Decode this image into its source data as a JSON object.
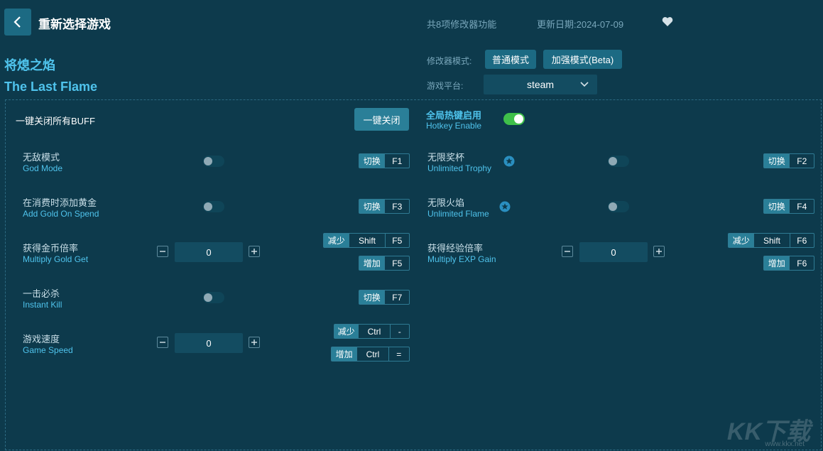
{
  "header": {
    "back_icon": "chevron-left-icon",
    "title": "重新选择游戏",
    "feature_count": "共8项修改器功能",
    "update_date": "更新日期:2024-07-09",
    "favorite_icon": "heart-icon"
  },
  "game": {
    "name_cn": "将熄之焰",
    "name_en": "The Last Flame"
  },
  "mode": {
    "label": "修改器模式:",
    "normal": "普通模式",
    "enhanced": "加强模式(Beta)"
  },
  "platform": {
    "label": "游戏平台:",
    "value": "steam"
  },
  "buff": {
    "label": "一键关闭所有BUFF",
    "button": "一键关闭"
  },
  "hotkey_enable": {
    "label_cn": "全局热键启用",
    "label_en": "Hotkey Enable",
    "on": true
  },
  "options_left": [
    {
      "cn": "无敌模式",
      "en": "God Mode",
      "type": "toggle",
      "on": false,
      "keys": [
        {
          "action": "切换",
          "keys": [
            "F1"
          ]
        }
      ]
    },
    {
      "cn": "在消费时添加黄金",
      "en": "Add Gold On Spend",
      "type": "toggle",
      "on": false,
      "keys": [
        {
          "action": "切换",
          "keys": [
            "F3"
          ]
        }
      ]
    },
    {
      "cn": "获得金币倍率",
      "en": "Multiply Gold Get",
      "type": "stepper",
      "value": "0",
      "keys": [
        {
          "action": "减少",
          "keys": [
            "Shift",
            "F5"
          ]
        },
        {
          "action": "增加",
          "keys": [
            "F5"
          ]
        }
      ]
    },
    {
      "cn": "一击必杀",
      "en": "Instant Kill",
      "type": "toggle",
      "on": false,
      "keys": [
        {
          "action": "切换",
          "keys": [
            "F7"
          ]
        }
      ]
    },
    {
      "cn": "游戏速度",
      "en": "Game Speed",
      "type": "stepper",
      "value": "0",
      "keys": [
        {
          "action": "减少",
          "keys": [
            "Ctrl",
            "-"
          ]
        },
        {
          "action": "增加",
          "keys": [
            "Ctrl",
            "="
          ]
        }
      ]
    }
  ],
  "options_right": [
    {
      "cn": "无限奖杯",
      "en": "Unlimited Trophy",
      "type": "toggle",
      "on": false,
      "starred": true,
      "keys": [
        {
          "action": "切换",
          "keys": [
            "F2"
          ]
        }
      ]
    },
    {
      "cn": "无限火焰",
      "en": "Unlimited Flame",
      "type": "toggle",
      "on": false,
      "starred": true,
      "keys": [
        {
          "action": "切换",
          "keys": [
            "F4"
          ]
        }
      ]
    },
    {
      "cn": "获得经验倍率",
      "en": "Multiply EXP Gain",
      "type": "stepper",
      "value": "0",
      "keys": [
        {
          "action": "减少",
          "keys": [
            "Shift",
            "F6"
          ]
        },
        {
          "action": "增加",
          "keys": [
            "F6"
          ]
        }
      ]
    }
  ],
  "watermark": {
    "text": "KK下载",
    "url": "www.kkx.net"
  },
  "colors": {
    "background": "#0d3a4c",
    "accent": "#4fc3ec",
    "button": "#1c6a83",
    "toggle_on": "#3fc04a"
  }
}
